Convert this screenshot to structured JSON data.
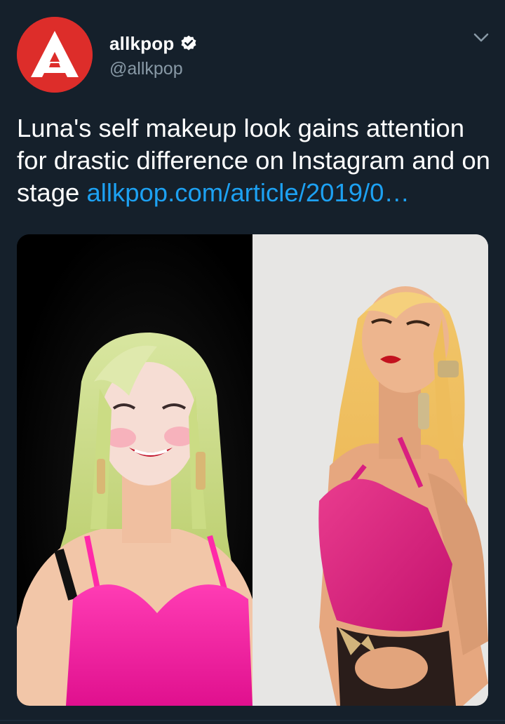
{
  "tweet": {
    "author": {
      "display_name": "allkpop",
      "handle": "@allkpop",
      "verified": true,
      "avatar_icon": "allkpop-logo-icon"
    },
    "text_plain": "Luna's self makeup look gains attention for drastic difference on Instagram and on stage ",
    "link_text": "allkpop.com/article/2019/0…",
    "menu_icon": "chevron-down-icon",
    "media": {
      "left_photo": "stage performance photo",
      "right_photo": "instagram self makeup photo"
    }
  },
  "colors": {
    "background": "#15202b",
    "text": "#ffffff",
    "secondary_text": "#8899a6",
    "link": "#1da1f2",
    "avatar_bg": "#dd2d2a"
  }
}
